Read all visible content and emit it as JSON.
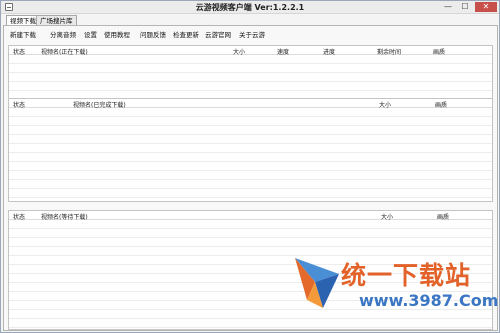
{
  "window": {
    "title": "云游视频客户端    Ver:1.2.2.1",
    "min": "—",
    "max": "☐",
    "close": "✕"
  },
  "tabs": [
    "视频下载",
    "广场搜片库"
  ],
  "toolbar": [
    "新建下载",
    "分离音频",
    "设置",
    "使用教程",
    "问题反馈",
    "检查更新",
    "云游官网",
    "关于云游"
  ],
  "downloading": {
    "columns": [
      "状态",
      "视频名(正在下载)",
      "大小",
      "速度",
      "进度",
      "剩余时间",
      "画质"
    ]
  },
  "completed": {
    "columns": [
      "状态",
      "视频名(已完成下载)",
      "大小",
      "画质"
    ]
  },
  "waiting": {
    "columns": [
      "状态",
      "视频名(等待下载)",
      "大小",
      "画质"
    ]
  },
  "watermark": {
    "text": "统一下载站",
    "url": "www.3987.Com"
  }
}
